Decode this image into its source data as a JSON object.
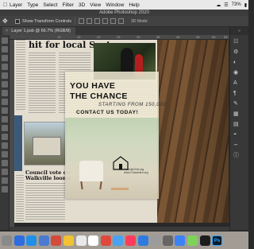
{
  "menubar": {
    "items": [
      "Layer",
      "Type",
      "Select",
      "Filter",
      "3D",
      "View",
      "Window",
      "Help"
    ],
    "battery": "73%"
  },
  "titlebar": {
    "title": "Adobe Photoshop 2020"
  },
  "options": {
    "show_transform_label": "Show Transform Controls",
    "mode_label": "3D Mode:"
  },
  "document": {
    "tab_label": "Layer 1.psb @ 66.7% (RGB/8)"
  },
  "ruler": {
    "ticks": [
      "10",
      "15",
      "20",
      "25",
      "30",
      "35",
      "40",
      "45",
      "50",
      "55"
    ]
  },
  "newspaper": {
    "headline": "hit for local Scot",
    "subhead_line1": "Council vote on",
    "subhead_line2": "Walkville looms"
  },
  "ad": {
    "line1": "YOU HAVE",
    "line2": "THE CHANCE",
    "starting": "STARTING FROM 150,000",
    "contact": "CONTACT US TODAY!",
    "url1": "Hello@CHA.org",
    "url2": "www.Chacentre.org"
  },
  "dock": {
    "colors": [
      "#8a8a8a",
      "#2e6de0",
      "#1f8fe8",
      "#4a7bd0",
      "#d34b3b",
      "#f1c232",
      "#e8e8e8",
      "#ffffff",
      "#e0493a",
      "#4aa3f0",
      "#fc3c5c",
      "#2f7be0",
      "#9c9c9c",
      "#666666",
      "#3b82f6",
      "#7dd35a",
      "#1c1c1c"
    ],
    "ps_label": "Ps"
  }
}
